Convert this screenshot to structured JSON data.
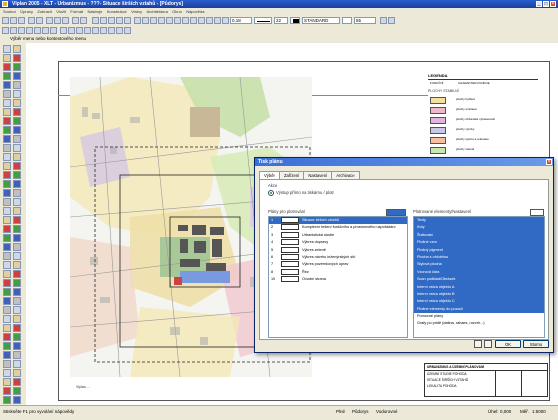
{
  "window": {
    "title": "Vlplan 2005 - XLT - Urbanizmus - ???- Situace širších vztahů - [Půdorys]"
  },
  "menu": [
    "Soubor",
    "Úpravy",
    "Zobrazit",
    "Vložit",
    "Formát",
    "Nástroje",
    "Konstrukce",
    "Vrstvy",
    "Architektura",
    "Okno",
    "Nápověda"
  ],
  "toolbar": {
    "line_width": "0.18",
    "layer": "22",
    "line_style": "STANDARD",
    "scale": "55"
  },
  "panel_header": "Výběr menu nebo kontextového menu",
  "legend": {
    "title": "LEGENDA",
    "col1": "FUNKČNÍ",
    "col2": "CHARAKTER FUNKCE",
    "subtitle": "PLOCHY STABILNÍ",
    "items": [
      {
        "label": "plochy bydlení",
        "color": "#f5e0a0"
      },
      {
        "label": "plochy smíšené",
        "color": "#f0b8c8"
      },
      {
        "label": "plochy občanské vybavenosti",
        "color": "#e4b4e0"
      },
      {
        "label": "plochy výroby",
        "color": "#c8c8e8"
      },
      {
        "label": "plochy sportu a rekreace",
        "color": "#f8c0a0"
      },
      {
        "label": "plochy zeleně",
        "color": "#c8e8b0"
      },
      {
        "label": "plochy dopravy",
        "color": "#d8d8d8"
      },
      {
        "label": "plochy vodní",
        "color": "#b8d8f0"
      },
      {
        "label": "plochy zemědělské",
        "color": "#e8e8c0"
      },
      {
        "label": "plochy přírodní",
        "color": "#a8d898"
      },
      {
        "label": "plochy lesní",
        "color": "#88c078"
      }
    ]
  },
  "titleblock": {
    "head": "URBANIZMUS A ÚZEMNÍ PLÁNOVÁNÍ",
    "rows": [
      "ÚZEMNÍ STUDIE POHODA",
      "SITUACE ŠIRŠÍCH VZTAHŮ",
      "LOKALITA POHODA"
    ]
  },
  "canvas_note": "Vlplan ...",
  "statusbar": {
    "hint": "Stiskněte F1 pro vyvolání nápovědy",
    "mode": "Plné",
    "view": "Půdorys",
    "layer": "Vodorovné",
    "zoom": "Úhel:",
    "zoom_val": "0,000",
    "scale": "Měř.",
    "scale_val": "1:5000"
  },
  "dialog": {
    "title": "Tisk plánu",
    "close": "×",
    "tabs": [
      "Výběr",
      "Zařízení",
      "Nastavení",
      "Archivace"
    ],
    "group_label": "Akce",
    "radio_label": "Výstup přímo na tiskárnu / plotr",
    "left_header": "Plány pro plotrování",
    "right_header": "Plotrované elementy/Nastavení",
    "plans": [
      {
        "num": "1",
        "name": "Situace širších vztahů",
        "selected": true
      },
      {
        "num": "2",
        "name": "Komplexní řešení funkčního a prostorového uspořádání",
        "selected": false
      },
      {
        "num": "3",
        "name": "Urbanistická studie",
        "selected": false
      },
      {
        "num": "4",
        "name": "Výkres dopravy",
        "selected": false
      },
      {
        "num": "5",
        "name": "Výkres zeleně",
        "selected": false
      },
      {
        "num": "6",
        "name": "Výkres návrhu inženýrských sítí",
        "selected": false
      },
      {
        "num": "7",
        "name": "Výkres pozemkových úprav",
        "selected": false
      },
      {
        "num": "8",
        "name": "Řez",
        "selected": false
      },
      {
        "num": "10",
        "name": "Ovodní strana",
        "selected": false
      }
    ],
    "elements": [
      {
        "name": "Texty",
        "hl": true
      },
      {
        "name": "Kóty",
        "hl": true
      },
      {
        "name": "Šrafování",
        "hl": true
      },
      {
        "name": "Plošné vzor",
        "hl": true
      },
      {
        "name": "Plošný pigment",
        "hl": true
      },
      {
        "name": "Plocha s ohlubňou",
        "hl": true
      },
      {
        "name": "Stylová plocha",
        "hl": true
      },
      {
        "name": "Vzorová čára",
        "hl": true
      },
      {
        "name": "Scan podklad/Obrázek",
        "hl": true
      },
      {
        "name": "Interní vstva objektu A",
        "hl": true
      },
      {
        "name": "Interní vstva objektu B",
        "hl": true
      },
      {
        "name": "Interní vstva objektu C",
        "hl": true
      },
      {
        "name": "Plošné elementy do pozadí",
        "hl": true
      },
      {
        "name": "Pomocné plány",
        "hl": false
      },
      {
        "name": "Grafy po pridě (datina, rahaes, rozvrh...)",
        "hl": false
      }
    ],
    "buttons": {
      "ok": "OK",
      "cancel": "Storno"
    }
  },
  "colors": {
    "accent": "#316ac5",
    "titlebar": "#2a5fd0"
  }
}
